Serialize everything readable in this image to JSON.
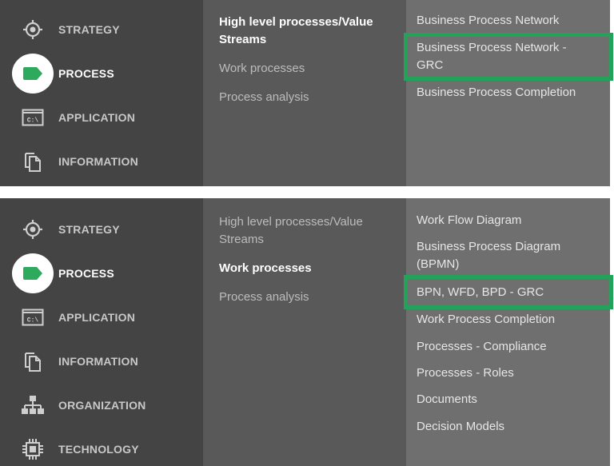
{
  "nav": {
    "strategy": "STRATEGY",
    "process": "PROCESS",
    "application": "APPLICATION",
    "information": "INFORMATION",
    "organization": "ORGANIZATION",
    "technology": "TECHNOLOGY"
  },
  "process_menu": {
    "value_streams": "High level processes/Value Streams",
    "work_processes": "Work processes",
    "process_analysis": "Process analysis"
  },
  "panel1": {
    "submenu": [
      "Business Process Network",
      "Business Process Network - GRC",
      "Business Process Completion"
    ],
    "highlighted": "Business Process Network - GRC"
  },
  "panel2": {
    "submenu": [
      "Work Flow Diagram",
      "Business Process Diagram (BPMN)",
      "BPN, WFD, BPD - GRC",
      "Work Process Completion",
      "Processes - Compliance",
      "Processes - Roles",
      "Documents",
      "Decision Models"
    ],
    "highlighted": "BPN, WFD, BPD - GRC"
  },
  "colors": {
    "nav_bg": "#444444",
    "menu_bg": "#595959",
    "submenu_bg": "#6f6f6f",
    "highlight": "#22a359",
    "process_icon": "#2eaa5d"
  }
}
